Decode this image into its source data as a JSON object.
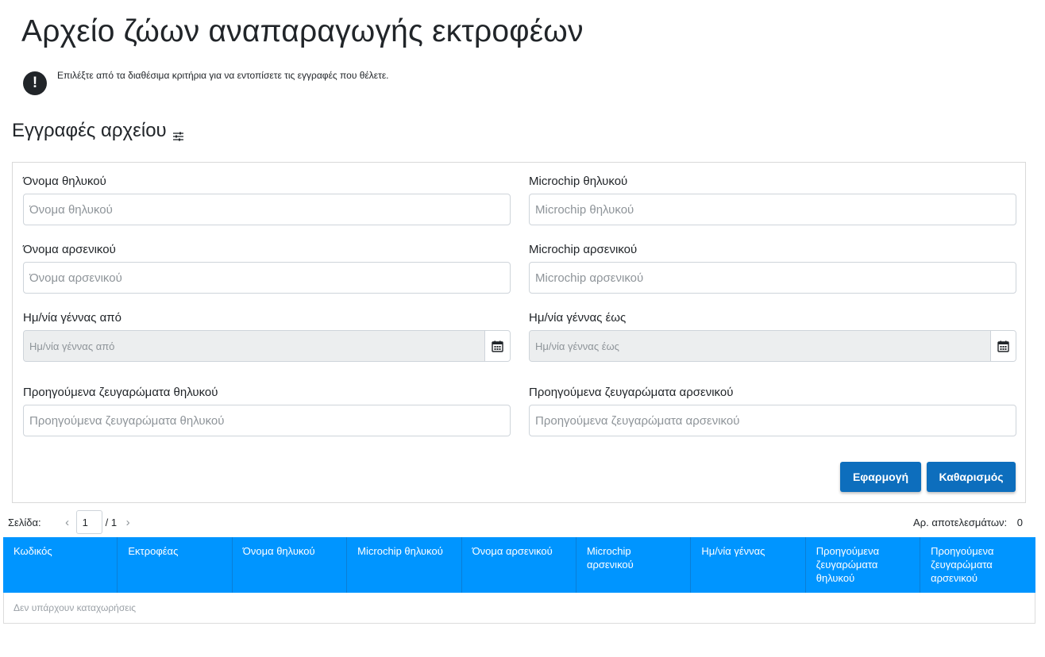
{
  "page": {
    "title": "Αρχείο ζώων αναπαραγωγής εκτροφέων",
    "notice": "Επιλέξτε από τα διαθέσιμα κριτήρια για να εντοπίσετε τις εγγραφές που θέλετε.",
    "notice_icon": "!"
  },
  "section": {
    "title": "Εγγραφές αρχείου",
    "icon": "sliders-icon"
  },
  "filters": {
    "female_name": {
      "label": "Όνομα θηλυκού",
      "placeholder": "Όνομα θηλυκού",
      "value": ""
    },
    "female_microchip": {
      "label": "Microchip θηλυκού",
      "placeholder": "Microchip θηλυκού",
      "value": ""
    },
    "male_name": {
      "label": "Όνομα αρσενικού",
      "placeholder": "Όνομα αρσενικού",
      "value": ""
    },
    "male_microchip": {
      "label": "Microchip αρσενικού",
      "placeholder": "Microchip αρσενικού",
      "value": ""
    },
    "birth_from": {
      "label": "Ημ/νία γέννας από",
      "placeholder": "Ημ/νία γέννας από",
      "value": ""
    },
    "birth_to": {
      "label": "Ημ/νία γέννας έως",
      "placeholder": "Ημ/νία γέννας έως",
      "value": ""
    },
    "female_prev_matings": {
      "label": "Προηγούμενα ζευγαρώματα θηλυκού",
      "placeholder": "Προηγούμενα ζευγαρώματα θηλυκού",
      "value": ""
    },
    "male_prev_matings": {
      "label": "Προηγούμενα ζευγαρώματα αρσενικού",
      "placeholder": "Προηγούμενα ζευγαρώματα αρσενικού",
      "value": ""
    },
    "apply_label": "Εφαρμογή",
    "clear_label": "Καθαρισμός"
  },
  "pager": {
    "page_label": "Σελίδα:",
    "prev": "‹",
    "next": "›",
    "current": "1",
    "total": "/ 1",
    "results_label": "Αρ. αποτελεσμάτων:",
    "results_count": "0"
  },
  "table": {
    "columns": [
      "Κωδικός",
      "Εκτροφέας",
      "Όνομα θηλυκού",
      "Microchip θηλυκού",
      "Όνομα αρσενικού",
      "Microchip αρσενικού",
      "Ημ/νία γέννας",
      "Προηγούμενα ζευγαρώματα θηλυκού",
      "Προηγούμενα ζευγαρώματα αρσενικού"
    ],
    "empty_text": "Δεν υπάρχουν καταχωρήσεις"
  },
  "colors": {
    "header_bg": "#0095ff",
    "button_bg": "#0d6ebd",
    "disabled_input_bg": "#eceeef"
  }
}
